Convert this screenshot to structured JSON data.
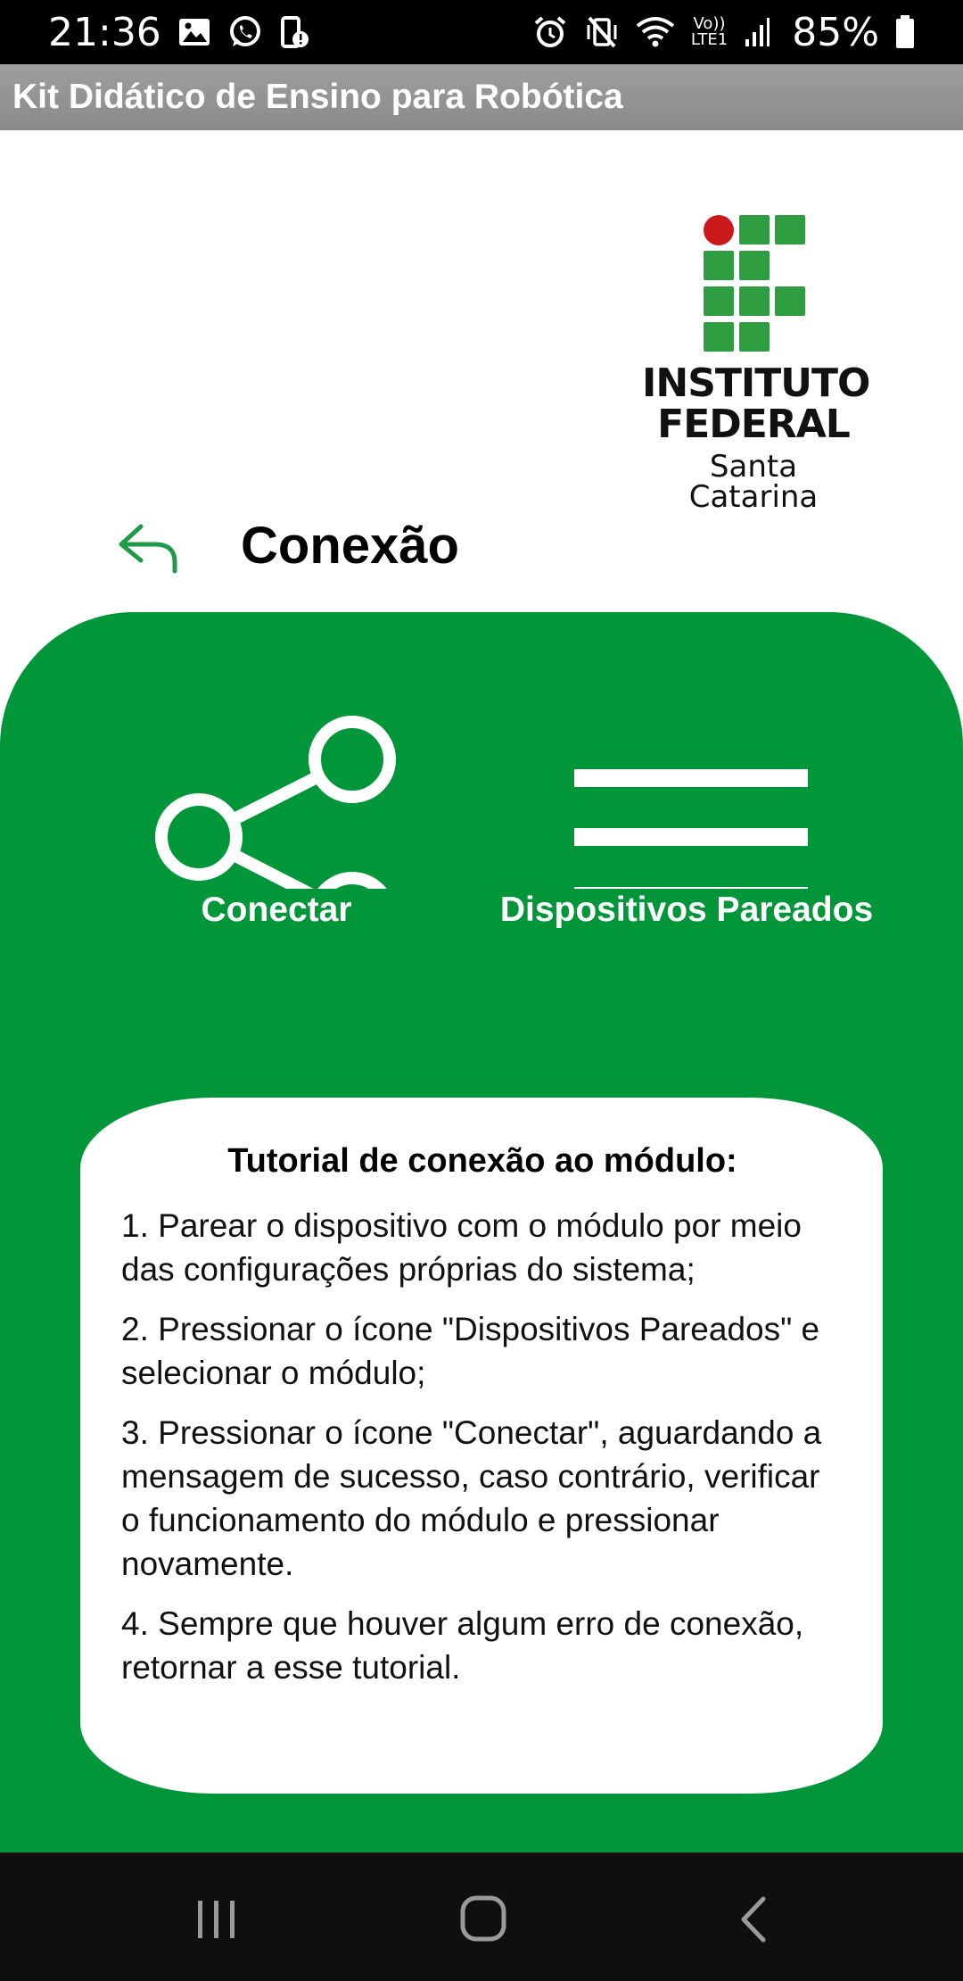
{
  "status_bar": {
    "time": "21:36",
    "battery_percent": "85%",
    "left_icons": [
      "image-icon",
      "whatsapp-icon",
      "usb-alert-icon"
    ],
    "right_icons": [
      "alarm-icon",
      "vibrate-mute-icon",
      "wifi-icon",
      "volte-icon",
      "signal-icon",
      "battery-icon"
    ],
    "volte_label_top": "Vo))",
    "volte_label_bottom": "LTE1"
  },
  "app_bar": {
    "title": "Kit Didático de Ensino para Robótica"
  },
  "logo": {
    "line1": "INSTITUTO",
    "line2": "FEDERAL",
    "line3": "Santa Catarina",
    "colors": {
      "green": "#2F9E41",
      "red": "#CD191E"
    }
  },
  "header": {
    "title": "Conexão",
    "back_icon": "back-arrow-icon"
  },
  "actions": {
    "connect": {
      "label": "Conectar",
      "icon": "share-icon"
    },
    "paired": {
      "label": "Dispositivos Pareados",
      "icon": "menu-icon"
    }
  },
  "tutorial": {
    "title": "Tutorial de conexão ao módulo:",
    "steps": [
      "1. Parear o dispositivo com o módulo por meio das configurações próprias do sistema;",
      "2. Pressionar o ícone \"Dispositivos Pareados\" e selecionar o módulo;",
      "3. Pressionar o ícone \"Conectar\", aguardando a mensagem de sucesso, caso contrário, verificar o funcionamento do módulo e pressionar novamente.",
      "4. Sempre que houver algum erro de conexão, retornar a esse tutorial."
    ]
  },
  "colors": {
    "panel_green": "#009639",
    "app_bar_gray": "#999999",
    "back_arrow_green": "#1f9a46"
  },
  "nav_bar": {
    "icons": [
      "recents-icon",
      "home-icon",
      "back-icon"
    ]
  }
}
